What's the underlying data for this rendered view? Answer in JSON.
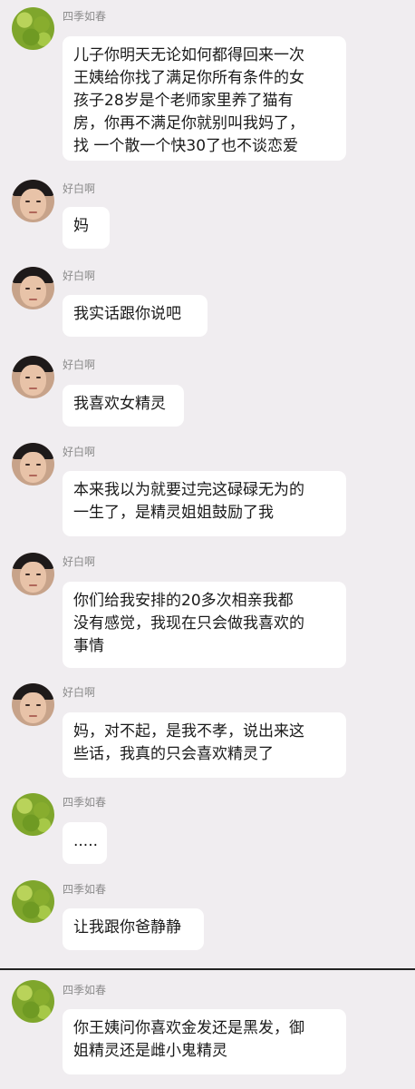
{
  "messages": [
    {
      "sender": "四季如春",
      "avatar": "green-leaves-avatar",
      "text": "儿子你明天无论如何都得回来一次\n王姨给你找了满足你所有条件的女\n孩子28岁是个老师家里养了猫有\n房，你再不满足你就别叫我妈了，\n找 一个散一个快30了也不谈恋爱"
    },
    {
      "sender": "好白啊",
      "avatar": "man-face-avatar",
      "text": "妈"
    },
    {
      "sender": "好白啊",
      "avatar": "man-face-avatar",
      "text": "我实话跟你说吧"
    },
    {
      "sender": "好白啊",
      "avatar": "man-face-avatar",
      "text": "我喜欢女精灵"
    },
    {
      "sender": "好白啊",
      "avatar": "man-face-avatar",
      "text": "本来我以为就要过完这碌碌无为的\n一生了，是精灵姐姐鼓励了我"
    },
    {
      "sender": "好白啊",
      "avatar": "man-face-avatar",
      "text": "你们给我安排的20多次相亲我都\n没有感觉，我现在只会做我喜欢的\n事情"
    },
    {
      "sender": "好白啊",
      "avatar": "man-face-avatar",
      "text": "妈，对不起，是我不孝，说出来这\n些话，我真的只会喜欢精灵了"
    },
    {
      "sender": "四季如春",
      "avatar": "green-leaves-avatar",
      "text": "....."
    },
    {
      "sender": "四季如春",
      "avatar": "green-leaves-avatar",
      "text": "让我跟你爸静静"
    },
    {
      "sender": "四季如春",
      "avatar": "green-leaves-avatar",
      "text": "你王姨问你喜欢金发还是黑发，御\n姐精灵还是雌小鬼精灵"
    }
  ]
}
